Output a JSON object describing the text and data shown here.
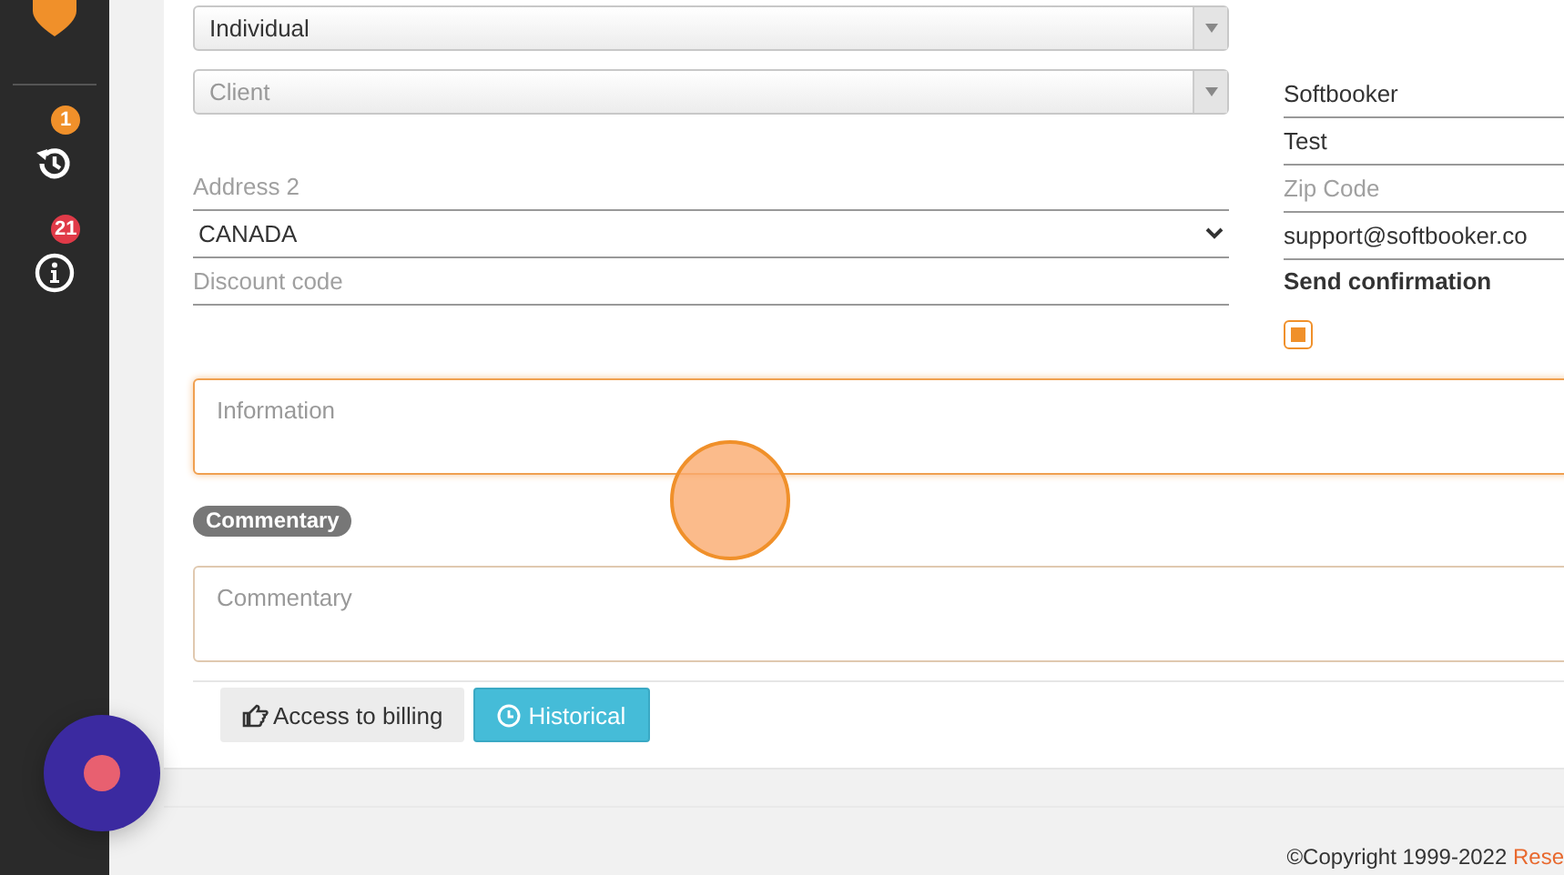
{
  "sidebar": {
    "items": [
      {
        "kind": "history",
        "badge": "1",
        "color": "#f0902a"
      },
      {
        "kind": "info",
        "badge": "21",
        "color": "#e03a48"
      }
    ]
  },
  "form": {
    "left": [
      {
        "kind": "combo",
        "value": "Individual",
        "placeholder": false
      },
      {
        "kind": "combo",
        "value": "Client",
        "placeholder": true
      },
      {
        "kind": "spacer"
      },
      {
        "kind": "input",
        "placeholder": "Address 2"
      },
      {
        "kind": "select",
        "value": "CANADA"
      },
      {
        "kind": "input",
        "placeholder": "Discount code"
      }
    ],
    "right": [
      {
        "kind": "input",
        "value": "Softbooker"
      },
      {
        "kind": "input",
        "value": "Test"
      },
      {
        "kind": "input",
        "placeholder": "Zip Code"
      },
      {
        "kind": "input",
        "value": "support@softbooker.co"
      }
    ],
    "send_confirmation": {
      "label": "Send confirmation",
      "checked": true
    },
    "information": {
      "placeholder": "Information",
      "focused": true
    },
    "commentary_badge": "Commentary",
    "commentary": {
      "placeholder": "Commentary",
      "focused": false
    },
    "buttons": [
      {
        "kind": "default",
        "label": "Access to billing"
      },
      {
        "kind": "info",
        "label": "Historical"
      }
    ]
  },
  "footer": {
    "text": "©Copyright 1999-2022 ",
    "link": "Rese"
  }
}
